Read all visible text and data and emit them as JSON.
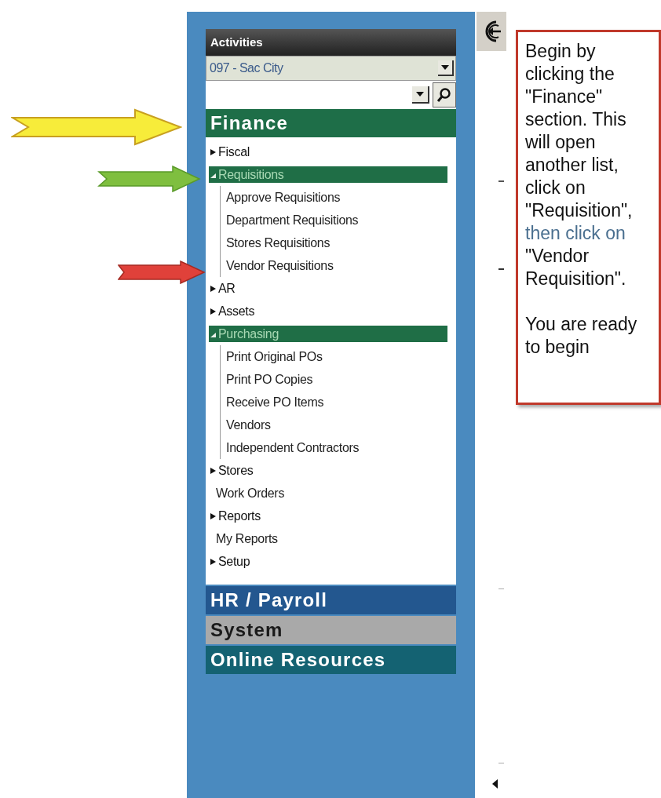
{
  "panel": {
    "title": "Activities",
    "district": {
      "value": "097 - Sac City"
    }
  },
  "sections": [
    {
      "label": "Finance",
      "color": "#1e6e48",
      "items": [
        {
          "label": "Fiscal",
          "kind": "folder",
          "expanded": false
        },
        {
          "label": "Requisitions",
          "kind": "folder",
          "expanded": true,
          "children": [
            {
              "label": "Approve Requisitions",
              "kind": "leaf"
            },
            {
              "label": "Department Requisitions",
              "kind": "leaf"
            },
            {
              "label": "Stores Requisitions",
              "kind": "leaf"
            },
            {
              "label": "Vendor Requisitions",
              "kind": "leaf"
            }
          ]
        },
        {
          "label": "AR",
          "kind": "folder",
          "expanded": false
        },
        {
          "label": "Assets",
          "kind": "folder",
          "expanded": false
        },
        {
          "label": "Purchasing",
          "kind": "folder",
          "expanded": true,
          "children": [
            {
              "label": "Print Original POs",
              "kind": "leaf"
            },
            {
              "label": "Print PO Copies",
              "kind": "leaf"
            },
            {
              "label": "Receive PO Items",
              "kind": "leaf"
            },
            {
              "label": "Vendors",
              "kind": "leaf"
            },
            {
              "label": "Independent Contractors",
              "kind": "leaf"
            }
          ]
        },
        {
          "label": "Stores",
          "kind": "folder",
          "expanded": false
        },
        {
          "label": "Work Orders",
          "kind": "leaf"
        },
        {
          "label": "Reports",
          "kind": "folder",
          "expanded": false
        },
        {
          "label": "My Reports",
          "kind": "leaf"
        },
        {
          "label": "Setup",
          "kind": "folder",
          "expanded": false
        }
      ]
    },
    {
      "label": "HR / Payroll",
      "color": "#23578f"
    },
    {
      "label": "System",
      "color": "#a9a9a9"
    },
    {
      "label": "Online Resources",
      "color": "#146272"
    }
  ],
  "callout": {
    "paragraphs": [
      [
        {
          "text": "Begin by clicking the \"Finance\" section. This will open another list, click on \"Requisition\","
        },
        {
          "text": "then click on",
          "highlighted": true
        },
        {
          "text": "\"Vendor Requisition\"."
        }
      ],
      [
        {
          "text": "You are ready to begin"
        }
      ]
    ]
  }
}
